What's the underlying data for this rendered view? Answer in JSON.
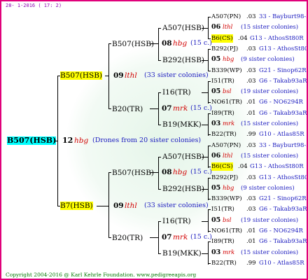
{
  "header_date": "28- 1-2016 ( 17: 2)",
  "footer": "Copyright 2004-2016 @ Karl Kehrle Foundation.   www.pedigreeapis.org",
  "root": {
    "name": "B507(HSB)",
    "gen": "12",
    "type": "hbg",
    "note": "(Drones from 20 sister colonies)"
  },
  "parents": [
    {
      "name": "B507(HSB)",
      "gen": "09",
      "type": "lthl",
      "note": "(33 sister colonies)"
    },
    {
      "name": "B7(HSB)",
      "gen": "09",
      "type": "lthl",
      "note": "(33 sister colonies)"
    }
  ],
  "grand": [
    {
      "name": "B507(HSB)",
      "gen": "08",
      "type": "hbg",
      "note": "(15 c.)"
    },
    {
      "name": "B20(TR)",
      "gen": "07",
      "type": "mrk",
      "note": "(15 c.)"
    },
    {
      "name": "B507(HSB)",
      "gen": "08",
      "type": "hbg",
      "note": "(15 c.)"
    },
    {
      "name": "B20(TR)",
      "gen": "07",
      "type": "mrk",
      "note": "(15 c.)"
    }
  ],
  "great": [
    "A507(HSB)",
    "B292(HSB)",
    "I16(TR)",
    "B19(MKK)",
    "A507(HSB)",
    "B292(HSB)",
    "I16(TR)",
    "B19(MKK)"
  ],
  "ggg_rows": [
    {
      "l": "A507(PN)",
      "r": ".03",
      "s": "33 - Bayburt98-3"
    },
    {
      "gen": "06",
      "type": "lthl",
      "note": "(15 sister colonies)"
    },
    {
      "l": "B6(CS)",
      "r": ".04",
      "s": "G13 - AthosSt80R",
      "hl": true
    },
    {
      "l": "B292(PJ)",
      "r": ".03",
      "s": "G13 - AthosSt80R"
    },
    {
      "gen": "05",
      "type": "hbg",
      "note": "(9 sister colonies)"
    },
    {
      "l": "B339(WP)",
      "r": ".03",
      "s": "G21 - Sinop62R"
    },
    {
      "l": "I51(TR)",
      "r": ".03",
      "s": "G6 - Takab93aR"
    },
    {
      "gen": "05",
      "type": "bsl",
      "note": "(19 sister colonies)"
    },
    {
      "l": "NO61(TR)",
      "r": ".01",
      "s": "G6 - NO6294R"
    },
    {
      "l": "I89(TR)",
      "r": ".01",
      "s": "G6 - Takab93aR"
    },
    {
      "gen": "03",
      "type": "mrk",
      "note": "(15 sister colonies)"
    },
    {
      "l": "B22(TR)",
      "r": ".99",
      "s": "G10 - Atlas85R"
    },
    {
      "l": "A507(PN)",
      "r": ".03",
      "s": "33 - Bayburt98-3"
    },
    {
      "gen": "06",
      "type": "lthl",
      "note": "(15 sister colonies)"
    },
    {
      "l": "B6(CS)",
      "r": ".04",
      "s": "G13 - AthosSt80R",
      "hl": true
    },
    {
      "l": "B292(PJ)",
      "r": ".03",
      "s": "G13 - AthosSt80R"
    },
    {
      "gen": "05",
      "type": "hbg",
      "note": "(9 sister colonies)"
    },
    {
      "l": "B339(WP)",
      "r": ".03",
      "s": "G21 - Sinop62R"
    },
    {
      "l": "I51(TR)",
      "r": ".03",
      "s": "G6 - Takab93aR"
    },
    {
      "gen": "05",
      "type": "bsl",
      "note": "(19 sister colonies)"
    },
    {
      "l": "NO61(TR)",
      "r": ".01",
      "s": "G6 - NO6294R"
    },
    {
      "l": "I89(TR)",
      "r": ".01",
      "s": "G6 - Takab93aR"
    },
    {
      "gen": "03",
      "type": "mrk",
      "note": "(15 sister colonies)"
    },
    {
      "l": "B22(TR)",
      "r": ".99",
      "s": "G10 - Atlas85R"
    }
  ]
}
